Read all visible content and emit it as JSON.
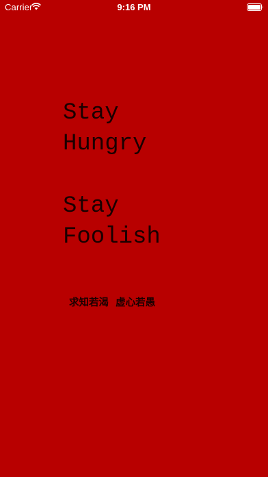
{
  "status_bar": {
    "carrier": "Carrier",
    "time": "9:16 PM",
    "wifi_icon": "wifi-icon",
    "battery_icon": "battery-icon"
  },
  "main": {
    "line1": "Stay",
    "line2": "Hungry",
    "line3": "Stay",
    "line4": "Foolish",
    "chinese": "求知若渴  虚心若愚"
  },
  "colors": {
    "background": "#b80000",
    "text": "#1a0000",
    "status_text": "#ffffff"
  }
}
